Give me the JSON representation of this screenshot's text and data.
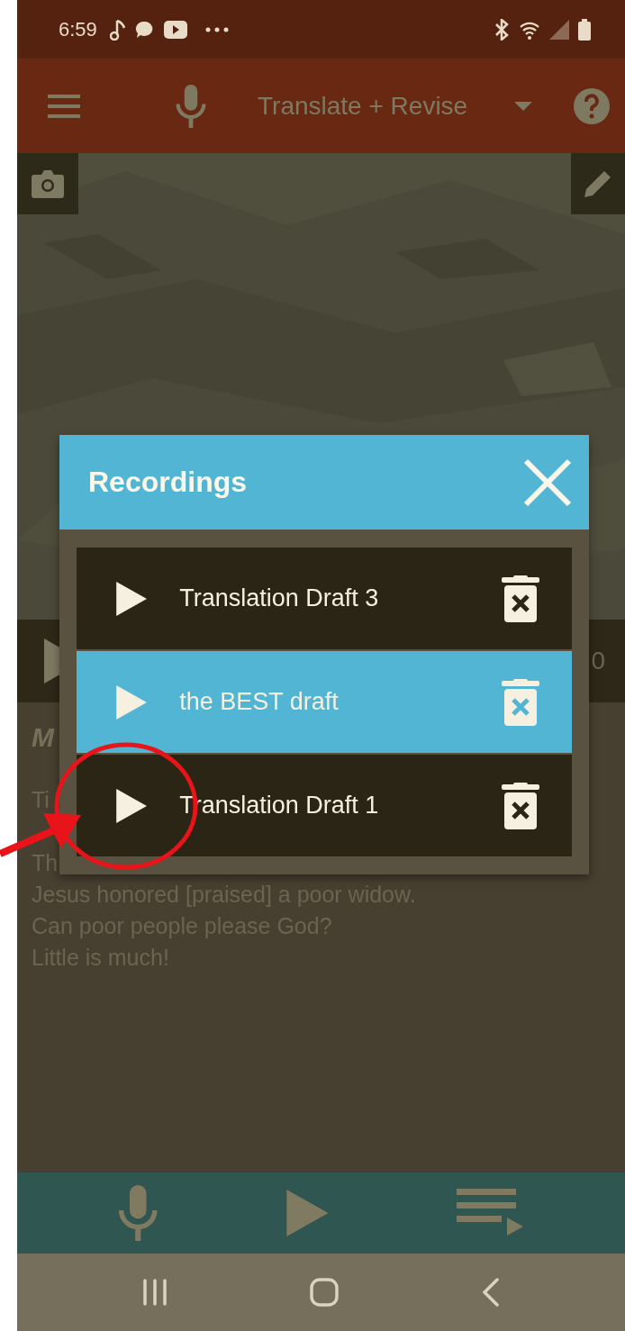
{
  "status_bar": {
    "time": "6:59"
  },
  "toolbar": {
    "title": "Translate + Revise"
  },
  "player": {
    "time_fragment": "0"
  },
  "text_heading": "M",
  "paragraphs": [
    [
      "Ti"
    ],
    [
      "Th",
      "Jesus honored [praised] a poor widow.",
      "Can poor people please God?",
      "Little is much!"
    ]
  ],
  "dialog": {
    "title": "Recordings",
    "recordings": [
      {
        "name": "Translation Draft 3",
        "selected": false
      },
      {
        "name": "the BEST draft",
        "selected": true
      },
      {
        "name": "Translation Draft 1",
        "selected": false
      }
    ]
  }
}
